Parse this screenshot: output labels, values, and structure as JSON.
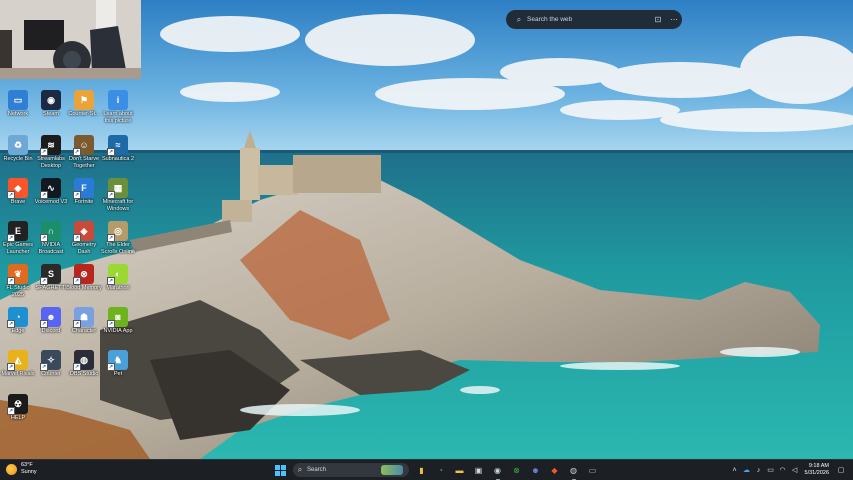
{
  "web_search": {
    "placeholder": "Search the web",
    "left_icon": "search-icon",
    "right_icons": [
      "camera-icon",
      "more-icon"
    ]
  },
  "desktop_icons": [
    {
      "label": "Network",
      "color": "#2f7fd6",
      "glyph": "▭"
    },
    {
      "label": "Steam",
      "color": "#1b2a44",
      "glyph": "◉"
    },
    {
      "label": "Counter-St...",
      "color": "#e8a33a",
      "glyph": "⚑"
    },
    {
      "label": "Learn about this picture",
      "color": "#3a8ee6",
      "glyph": "i"
    },
    {
      "label": "Recycle Bin",
      "color": "#6fa7d6",
      "glyph": "♻"
    },
    {
      "label": "Streamlabs Desktop",
      "color": "#1c1c1c",
      "glyph": "≋"
    },
    {
      "label": "Don't Starve Together",
      "color": "#7a5a2e",
      "glyph": "☺"
    },
    {
      "label": "Subnautica 2",
      "color": "#1e6aa8",
      "glyph": "≈"
    },
    {
      "label": "Brave",
      "color": "#fb542b",
      "glyph": "◆"
    },
    {
      "label": "Voicemod V3",
      "color": "#101820",
      "glyph": "∿"
    },
    {
      "label": "Fortnite",
      "color": "#2a7ad8",
      "glyph": "F"
    },
    {
      "label": "Minecraft for Windows",
      "color": "#6b8f3a",
      "glyph": "▦"
    },
    {
      "label": "Epic Games Launcher",
      "color": "#222",
      "glyph": "E"
    },
    {
      "label": "NVIDIA Broadcast",
      "color": "#1a8f6a",
      "glyph": "∩"
    },
    {
      "label": "Geometry Dash",
      "color": "#c84a3a",
      "glyph": "◈"
    },
    {
      "label": "The Elder Scrolls Online",
      "color": "#b59a6a",
      "glyph": "◎"
    },
    {
      "label": "FL Studio 2025",
      "color": "#e06b1e",
      "glyph": "❦"
    },
    {
      "label": "SPAGHETTI",
      "color": "#2a2a2a",
      "glyph": "S"
    },
    {
      "label": "Blood Memory",
      "color": "#b8261e",
      "glyph": "⊗"
    },
    {
      "label": "Marathon",
      "color": "#9bd832",
      "glyph": "◐"
    },
    {
      "label": "Edge",
      "color": "#1e8fd0",
      "glyph": "◔"
    },
    {
      "label": "Discord",
      "color": "#5865f2",
      "glyph": "☻"
    },
    {
      "label": "Character",
      "color": "#7aa0e0",
      "glyph": "☗"
    },
    {
      "label": "NVIDIA App",
      "color": "#6db31e",
      "glyph": "◙"
    },
    {
      "label": "Marvel Rivals",
      "color": "#e8b21e",
      "glyph": "◭"
    },
    {
      "label": "Counter",
      "color": "#3a4a5a",
      "glyph": "✧"
    },
    {
      "label": "OBS Studio",
      "color": "#2b2e38",
      "glyph": "◍"
    },
    {
      "label": "Pet",
      "color": "#4aa0d8",
      "glyph": "♞"
    },
    {
      "label": "HELP",
      "color": "#1a1a1a",
      "glyph": "☢"
    }
  ],
  "taskbar": {
    "weather": {
      "temp": "63°F",
      "condition": "Sunny"
    },
    "search_label": "Search",
    "pinned": [
      {
        "name": "file-explorer-icon",
        "glyph": "▮",
        "color": "#e8c14a"
      },
      {
        "name": "edge-icon",
        "glyph": "◔",
        "color": "#3aa0e6"
      },
      {
        "name": "folder-icon",
        "glyph": "▬",
        "color": "#f2c14e"
      },
      {
        "name": "store-icon",
        "glyph": "▣",
        "color": "#d8d8d8"
      },
      {
        "name": "steam-icon",
        "glyph": "◉",
        "color": "#c7d5e0"
      },
      {
        "name": "xbox-icon",
        "glyph": "⊗",
        "color": "#3cb043"
      },
      {
        "name": "discord-icon",
        "glyph": "☻",
        "color": "#7289da"
      },
      {
        "name": "brave-icon",
        "glyph": "◆",
        "color": "#fb542b"
      },
      {
        "name": "obs-icon",
        "glyph": "◍",
        "color": "#d0d0d0"
      },
      {
        "name": "terminal-icon",
        "glyph": "▭",
        "color": "#bfbfbf"
      }
    ],
    "tray_icons": [
      "chevron-up-icon",
      "cloud-icon",
      "microphone-icon",
      "network-icon",
      "wifi-icon",
      "volume-icon"
    ],
    "time": "9:18 AM",
    "date": "5/31/2026"
  }
}
